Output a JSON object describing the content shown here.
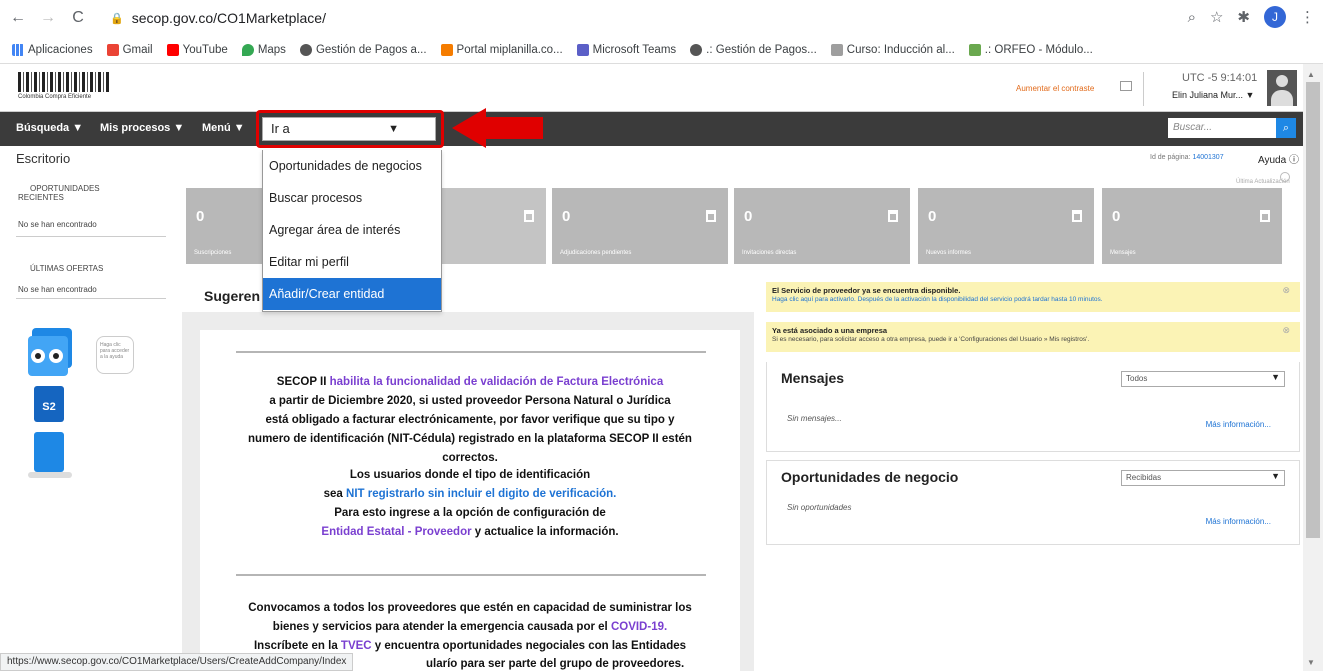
{
  "browser": {
    "url": "secop.gov.co/CO1Marketplace/",
    "profile_initial": "J",
    "bookmarks": [
      "Aplicaciones",
      "Gmail",
      "YouTube",
      "Maps",
      "Gestión de Pagos a...",
      "Portal miplanilla.co...",
      "Microsoft Teams",
      ".: Gestión de Pagos...",
      "Curso: Inducción al...",
      ".: ORFEO - Módulo..."
    ],
    "status_url": "https://www.secop.gov.co/CO1Marketplace/Users/CreateAddCompany/Index"
  },
  "header": {
    "logo_text": "Colombia Compra Eficiente",
    "font_link": "Aumentar el contraste",
    "utc": "UTC -5 9:14:01",
    "user": "Elin Juliana Mur..."
  },
  "menubar": {
    "busqueda": "Búsqueda ▼",
    "mis_procesos": "Mis procesos ▼",
    "menu": "Menú ▼",
    "ira": "Ir a",
    "search_placeholder": "Buscar..."
  },
  "dropdown": {
    "items": [
      "Oportunidades de negocios",
      "Buscar procesos",
      "Agregar área de interés",
      "Editar mi perfil",
      "Añadir/Crear entidad"
    ]
  },
  "page": {
    "title": "Escritorio",
    "page_id_label": "Id de página:",
    "page_id_value": "14001307",
    "ayuda": "Ayuda",
    "ultima": "Última Actualización"
  },
  "sidebar": {
    "recent_heading_1": "OPORTUNIDADES",
    "recent_heading_2": "RECIENTES",
    "recent_value": "No se han encontrado",
    "offers_heading": "ÚLTIMAS OFERTAS",
    "offers_value": "No se han encontrado",
    "bubble_text": "Haga clic para acceder a la ayuda",
    "mascot_label": "S2"
  },
  "tiles": [
    {
      "num": "0",
      "label": "Suscripciones"
    },
    {
      "num": "0",
      "label": "Adjudicaciones pendientes"
    },
    {
      "num": "0",
      "label": "Invitaciones directas"
    },
    {
      "num": "0",
      "label": "Nuevos informes"
    },
    {
      "num": "0",
      "label": "Mensajes"
    }
  ],
  "suggestions": {
    "title": "Sugeren",
    "notice_1": {
      "secop": "SECOP II ",
      "link": "habilita la funcionalidad de validación de Factura Electrónica",
      "l2": "a partir de Diciembre 2020, si usted proveedor Persona Natural o Jurídica",
      "l3": "está obligado a facturar electrónicamente, por favor verifique que su tipo y",
      "l4": "numero de identificación (NIT-Cédula) registrado en la plataforma SECOP II estén",
      "l5": "correctos.",
      "l6": "Los usuarios donde el tipo de identificación",
      "l7_pre": "sea ",
      "l7_link": "NIT registrarlo sin incluir el digito de verificación.",
      "l8": "Para esto ingrese a la opción de configuración de",
      "l9_link": "Entidad Estatal - Proveedor",
      "l9_post": " y actualice la información."
    },
    "notice_2": {
      "l1": "Convocamos a todos los proveedores que estén en capacidad de suministrar los",
      "l2_pre": "bienes y servicios para atender la emergencia causada por el ",
      "l2_link": "COVID-19.",
      "l3_pre": "Inscríbete en la ",
      "l3_link": "TVEC",
      "l3_post": " y encuentra oportunidades negociales con las Entidades",
      "l4": "ularío para ser parte del grupo de proveedores."
    }
  },
  "alerts": [
    {
      "title": "El Servicio de proveedor ya se encuentra disponible.",
      "text": "Haga clic aquí para activarlo. Después de la activación la disponibilidad del servicio podrá tardar hasta 10 minutos."
    },
    {
      "title": "Ya está asociado a una empresa",
      "text": "Si es necesario, para solicitar acceso a otra empresa, puede ir a 'Configuraciones del Usuario » Mis registros'."
    }
  ],
  "messages": {
    "title": "Mensajes",
    "filter": "Todos",
    "empty": "Sin mensajes...",
    "more": "Más información..."
  },
  "opportunities": {
    "title": "Oportunidades de negocio",
    "filter": "Recibidas",
    "empty": "Sin oportunidades",
    "more": "Más información..."
  }
}
